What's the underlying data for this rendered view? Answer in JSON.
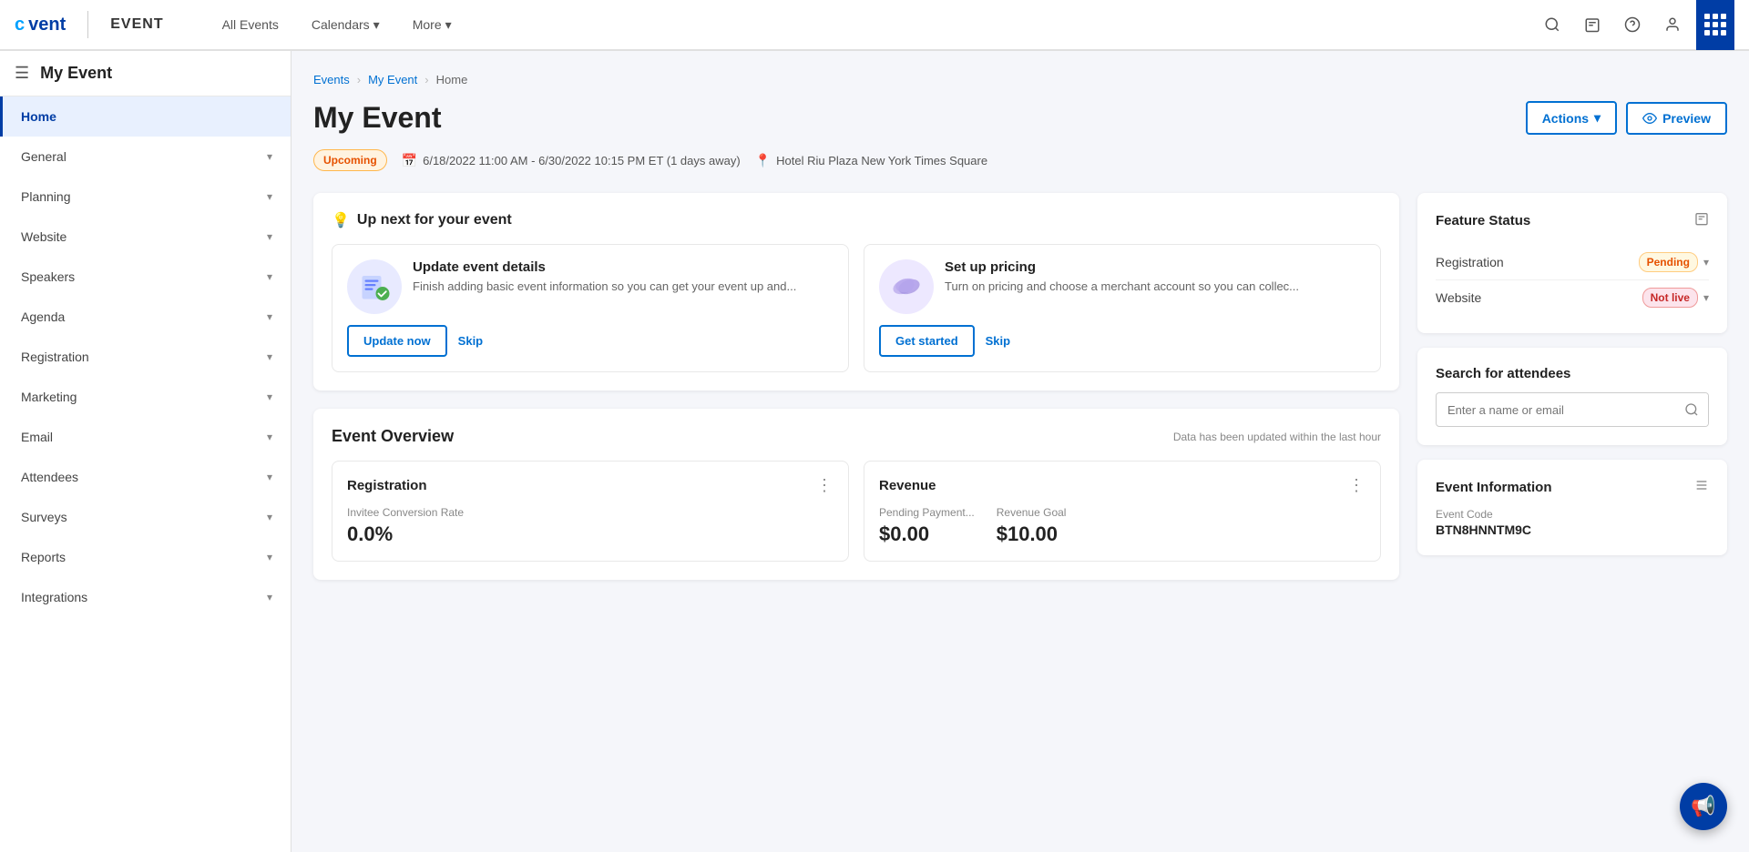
{
  "topNav": {
    "logoC": "c",
    "logoVent": "vent",
    "logoEvent": "EVENT",
    "links": [
      {
        "label": "All Events",
        "hasChevron": false
      },
      {
        "label": "Calendars",
        "hasChevron": true
      },
      {
        "label": "More",
        "hasChevron": true
      }
    ],
    "icons": [
      "search",
      "badge",
      "help",
      "user",
      "apps"
    ]
  },
  "sidebar": {
    "title": "My Event",
    "items": [
      {
        "label": "Home",
        "active": true,
        "hasChevron": false
      },
      {
        "label": "General",
        "active": false,
        "hasChevron": true
      },
      {
        "label": "Planning",
        "active": false,
        "hasChevron": true
      },
      {
        "label": "Website",
        "active": false,
        "hasChevron": true
      },
      {
        "label": "Speakers",
        "active": false,
        "hasChevron": true
      },
      {
        "label": "Agenda",
        "active": false,
        "hasChevron": true
      },
      {
        "label": "Registration",
        "active": false,
        "hasChevron": true
      },
      {
        "label": "Marketing",
        "active": false,
        "hasChevron": true
      },
      {
        "label": "Email",
        "active": false,
        "hasChevron": true
      },
      {
        "label": "Attendees",
        "active": false,
        "hasChevron": true
      },
      {
        "label": "Surveys",
        "active": false,
        "hasChevron": true
      },
      {
        "label": "Reports",
        "active": false,
        "hasChevron": true
      },
      {
        "label": "Integrations",
        "active": false,
        "hasChevron": true
      }
    ]
  },
  "breadcrumb": {
    "items": [
      "Events",
      "My Event",
      "Home"
    ]
  },
  "pageTitle": "My Event",
  "headerButtons": {
    "actions": "Actions",
    "actionsChevron": "▾",
    "previewIcon": "👁",
    "preview": "Preview"
  },
  "eventMeta": {
    "badge": "Upcoming",
    "dateRange": "6/18/2022 11:00 AM - 6/30/2022 10:15 PM ET (1 days away)",
    "location": "Hotel Riu Plaza New York Times Square"
  },
  "upNext": {
    "title": "Up next for your event",
    "icon": "💡",
    "items": [
      {
        "title": "Update event details",
        "description": "Finish adding basic event information so you can get your event up and...",
        "primaryBtn": "Update now",
        "skipBtn": "Skip",
        "iconEmoji": "📋"
      },
      {
        "title": "Set up pricing",
        "description": "Turn on pricing and choose a merchant account so you can collec...",
        "primaryBtn": "Get started",
        "skipBtn": "Skip",
        "iconEmoji": "🎫"
      }
    ]
  },
  "eventOverview": {
    "title": "Event Overview",
    "dataUpdated": "Data has been updated within the last hour",
    "cards": [
      {
        "title": "Registration",
        "stats": [
          {
            "label": "Invitee Conversion Rate",
            "value": "0.0%"
          }
        ]
      },
      {
        "title": "Revenue",
        "stats": [
          {
            "label": "Pending Payment...",
            "value": "$0.00"
          },
          {
            "label": "Revenue Goal",
            "value": "$10.00"
          }
        ]
      }
    ]
  },
  "rightPanel": {
    "featureStatus": {
      "title": "Feature Status",
      "items": [
        {
          "name": "Registration",
          "status": "Pending",
          "statusType": "pending"
        },
        {
          "name": "Website",
          "status": "Not live",
          "statusType": "notlive"
        }
      ]
    },
    "searchAttendees": {
      "title": "Search for attendees",
      "placeholder": "Enter a name or email"
    },
    "eventInfo": {
      "title": "Event Information",
      "fields": [
        {
          "label": "Event Code",
          "value": "BTN8HNNTM9C"
        }
      ]
    }
  },
  "fab": {
    "icon": "📢"
  }
}
